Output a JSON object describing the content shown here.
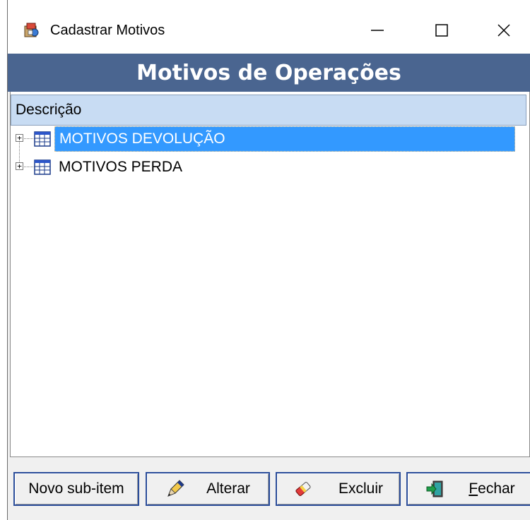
{
  "window": {
    "title": "Cadastrar Motivos"
  },
  "banner": {
    "title": "Motivos de Operações"
  },
  "tree": {
    "column_header": "Descrição",
    "items": [
      {
        "label": "MOTIVOS DEVOLUÇÃO",
        "selected": true,
        "icon": "table-icon"
      },
      {
        "label": "MOTIVOS PERDA",
        "selected": false,
        "icon": "table-icon"
      }
    ]
  },
  "buttons": {
    "novo": "Novo sub-item",
    "alterar": "Alterar",
    "excluir": "Excluir",
    "fechar": "Fechar"
  },
  "colors": {
    "banner": "#4a6590",
    "selection": "#3399ff",
    "header": "#c8dcf3",
    "button_border": "#2b4d9a"
  }
}
